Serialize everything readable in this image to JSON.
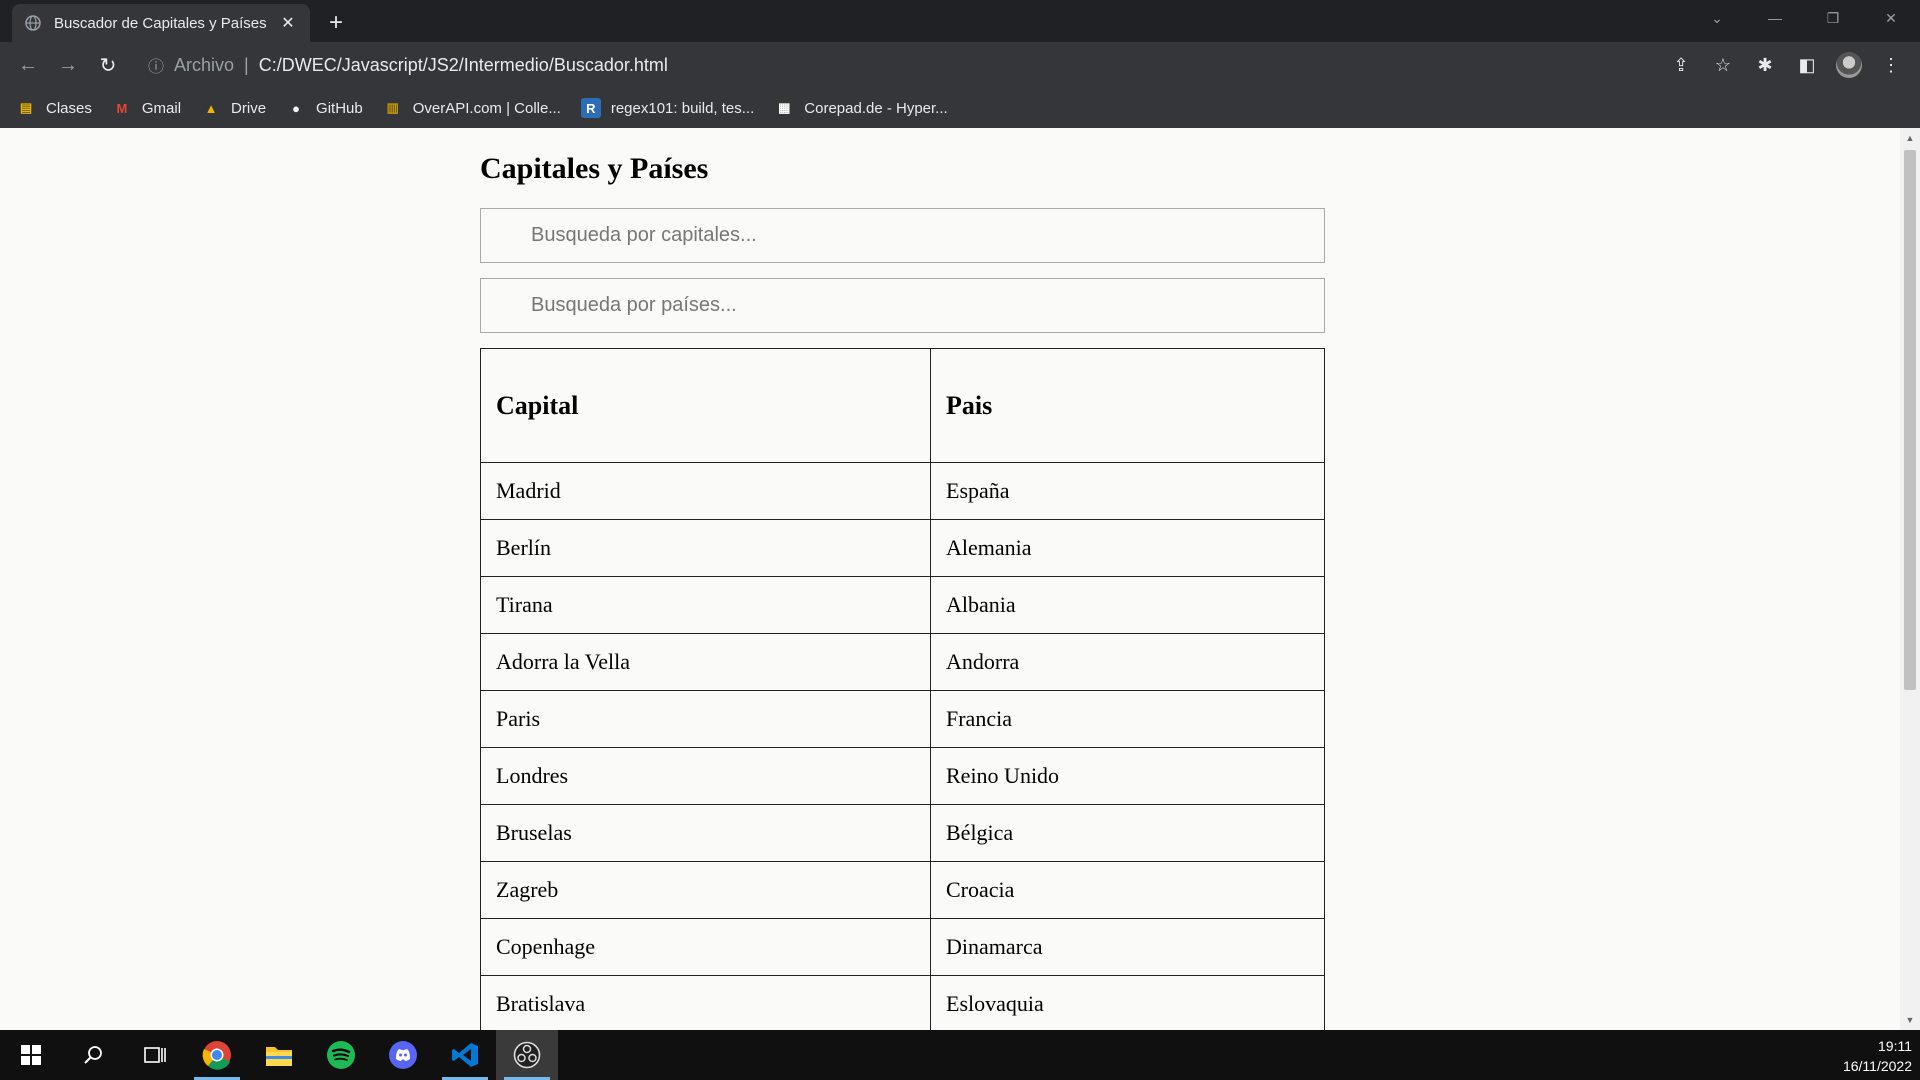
{
  "browser": {
    "tab_title": "Buscador de Capitales y Países",
    "tab_close": "✕",
    "new_tab": "+",
    "win_controls": [
      "⌄",
      "—",
      "❐",
      "✕"
    ],
    "omnibox": {
      "info": "ⓘ",
      "scheme": "Archivo",
      "separator": "|",
      "url": "C:/DWEC/Javascript/JS2/Intermedio/Buscador.html"
    },
    "nav": {
      "back": "←",
      "forward": "→",
      "reload": "↻"
    },
    "toolbar_icons": {
      "share": "⇪",
      "star": "☆",
      "extensions": "✱",
      "sidepanel": "◧",
      "menu": "⋮"
    },
    "bookmarks": [
      {
        "label": "Clases",
        "icon": "folder-icon",
        "glyph": "▤",
        "color": "#e8b300"
      },
      {
        "label": "Gmail",
        "icon": "gmail-icon",
        "glyph": "M",
        "color": "#ea4335"
      },
      {
        "label": "Drive",
        "icon": "drive-icon",
        "glyph": "▲",
        "color": "#f4b400"
      },
      {
        "label": "GitHub",
        "icon": "github-icon",
        "glyph": "●",
        "color": "#ffffff"
      },
      {
        "label": "OverAPI.com | Colle...",
        "icon": "overapi-icon",
        "glyph": "▥",
        "color": "#c49a00"
      },
      {
        "label": "regex101: build, tes...",
        "icon": "regex101-icon",
        "glyph": "R",
        "color": "#2d6db5"
      },
      {
        "label": "Corepad.de - Hyper...",
        "icon": "corepad-icon",
        "glyph": "▦",
        "color": "#ffffff"
      }
    ]
  },
  "page": {
    "heading": "Capitales y Países",
    "search_capital_placeholder": "Busqueda por capitales...",
    "search_country_placeholder": "Busqueda por países...",
    "table": {
      "headers": [
        "Capital",
        "Pais"
      ],
      "rows": [
        [
          "Madrid",
          "España"
        ],
        [
          "Berlín",
          "Alemania"
        ],
        [
          "Tirana",
          "Albania"
        ],
        [
          "Adorra la Vella",
          "Andorra"
        ],
        [
          "Paris",
          "Francia"
        ],
        [
          "Londres",
          "Reino Unido"
        ],
        [
          "Bruselas",
          "Bélgica"
        ],
        [
          "Zagreb",
          "Croacia"
        ],
        [
          "Copenhage",
          "Dinamarca"
        ],
        [
          "Bratislava",
          "Eslovaquia"
        ]
      ]
    }
  },
  "taskbar": {
    "time": "19:11",
    "date": "16/11/2022",
    "apps": [
      {
        "name": "windows-start-icon",
        "active": false
      },
      {
        "name": "search-icon",
        "active": false
      },
      {
        "name": "task-view-icon",
        "active": false
      },
      {
        "name": "chrome-icon",
        "active": true
      },
      {
        "name": "file-explorer-icon",
        "active": false
      },
      {
        "name": "spotify-icon",
        "active": false
      },
      {
        "name": "discord-icon",
        "active": false
      },
      {
        "name": "vscode-icon",
        "active": true
      },
      {
        "name": "obs-icon",
        "active": true
      }
    ]
  }
}
